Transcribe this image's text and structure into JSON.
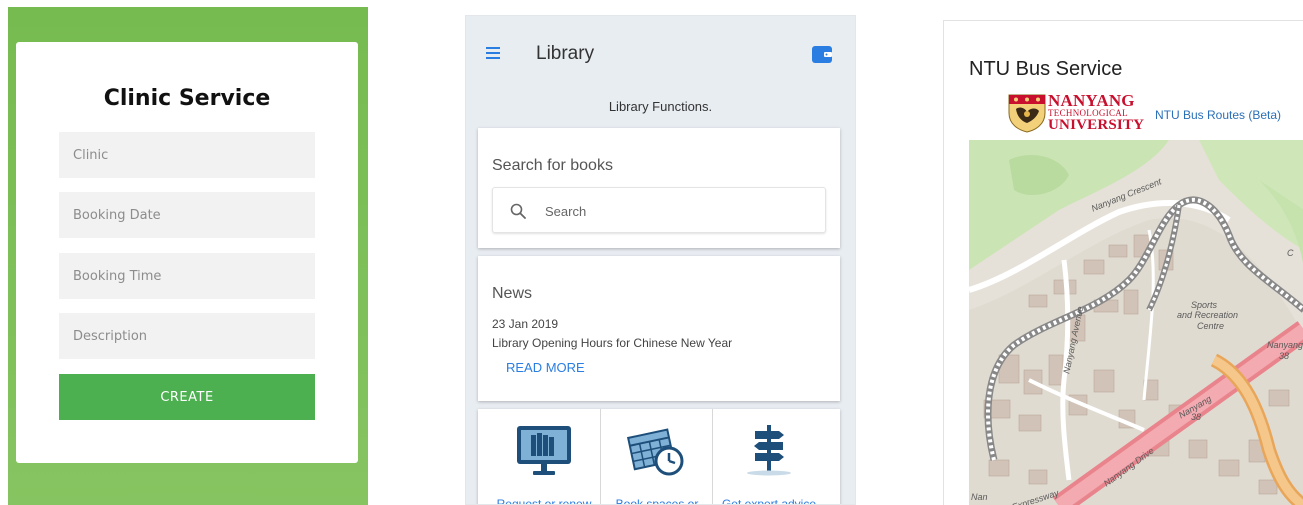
{
  "clinic": {
    "title": "Clinic Service",
    "fields": {
      "clinic": "Clinic",
      "booking_date": "Booking Date",
      "booking_time": "Booking Time",
      "description": "Description"
    },
    "create_label": "CREATE",
    "colors": {
      "background": "#7dbf57",
      "button": "#4caf50"
    }
  },
  "library": {
    "title": "Library",
    "subtitle": "Library Functions.",
    "search": {
      "heading": "Search for books",
      "placeholder": "Search"
    },
    "news": {
      "heading": "News",
      "date": "23 Jan 2019",
      "text": "Library Opening Hours for Chinese New Year",
      "read_more": "READ MORE"
    },
    "services": [
      {
        "label": "Request or renew",
        "icon": "computer-books-icon"
      },
      {
        "label": "Book spaces or",
        "icon": "calendar-clock-icon"
      },
      {
        "label": "Get expert advice",
        "icon": "signpost-icon"
      }
    ],
    "colors": {
      "accent": "#2a7de1",
      "background": "#e8edf2"
    }
  },
  "bus": {
    "title": "NTU Bus Service",
    "logo": {
      "line1": "NANYANG",
      "line2": "TECHNOLOGICAL",
      "line3": "UNIVERSITY"
    },
    "link": "NTU Bus Routes (Beta)",
    "map_labels": {
      "crescent": "Nanyang Crescent",
      "sports": "Sports",
      "and_rec": "and Recreation",
      "centre": "Centre",
      "avenue": "Nanyang Avenue",
      "nanyang_38a": "Nanyang",
      "num_38a": "38",
      "nanyang_38b": "Nanyang",
      "num_38b": "38",
      "drive": "Nanyang Drive",
      "expressway": "Expressway",
      "na": "Nan",
      "c": "C"
    },
    "colors": {
      "brand": "#c8102e",
      "link": "#2a6fb8",
      "highway": "#e9848d"
    }
  }
}
